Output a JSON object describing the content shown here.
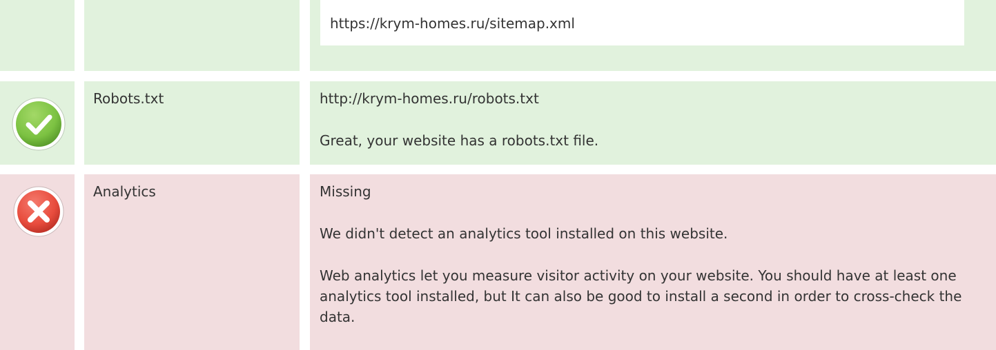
{
  "sitemap": {
    "url": "https://krym-homes.ru/sitemap.xml",
    "status": "good"
  },
  "robots": {
    "label": "Robots.txt",
    "url": "http://krym-homes.ru/robots.txt",
    "message": "Great, your website has a robots.txt file.",
    "status": "good"
  },
  "analytics": {
    "label": "Analytics",
    "value": "Missing",
    "message": "We didn't detect an analytics tool installed on this website.",
    "description": "Web analytics let you measure visitor activity on your website. You should have at least one analytics tool installed, but It can also be good to install a second in order to cross-check the data.",
    "status": "bad"
  },
  "icons": {
    "pass": "check-circle-icon",
    "fail": "cross-circle-icon"
  },
  "colors": {
    "good_bg": "#e1f2dd",
    "bad_bg": "#f2dddf",
    "check_green": "#7cc242",
    "cross_red": "#e84c3d"
  }
}
